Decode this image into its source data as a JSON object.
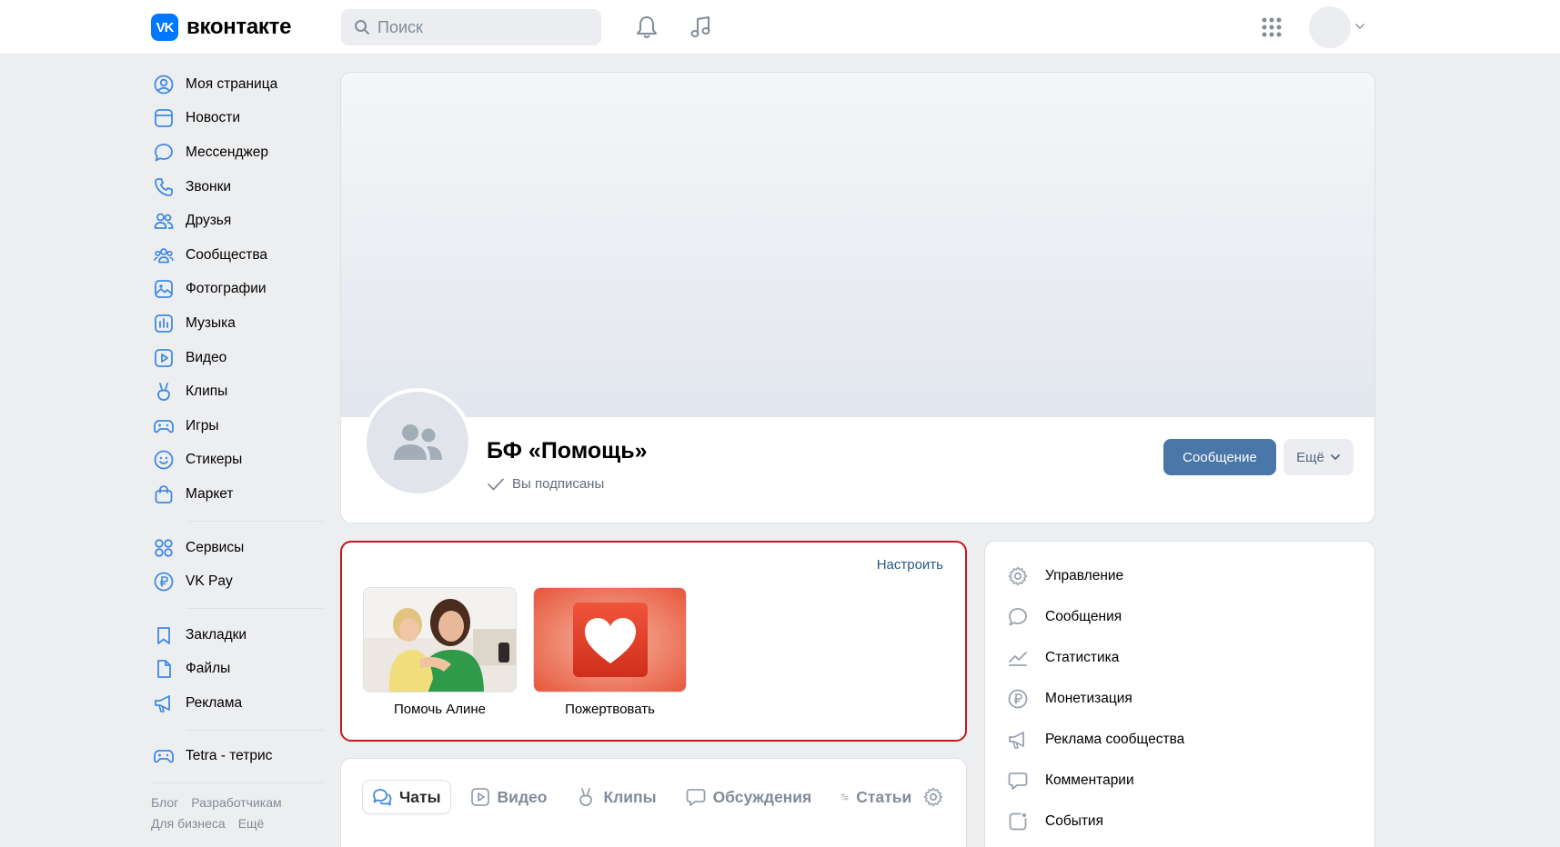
{
  "header": {
    "logo_mark": "VK",
    "logo_text": "вконтакте",
    "search_placeholder": "Поиск",
    "icons": [
      "bell-icon",
      "music-icon",
      "apps-grid-icon",
      "chevron-down-icon"
    ]
  },
  "sidebar": {
    "items": [
      {
        "label": "Моя страница",
        "icon": "user-circle-icon"
      },
      {
        "label": "Новости",
        "icon": "news-icon"
      },
      {
        "label": "Мессенджер",
        "icon": "message-icon"
      },
      {
        "label": "Звонки",
        "icon": "phone-icon"
      },
      {
        "label": "Друзья",
        "icon": "friends-icon"
      },
      {
        "label": "Сообщества",
        "icon": "communities-icon"
      },
      {
        "label": "Фотографии",
        "icon": "photo-icon"
      },
      {
        "label": "Музыка",
        "icon": "music-icon"
      },
      {
        "label": "Видео",
        "icon": "video-icon"
      },
      {
        "label": "Клипы",
        "icon": "clips-icon"
      },
      {
        "label": "Игры",
        "icon": "gamepad-icon"
      },
      {
        "label": "Стикеры",
        "icon": "smile-icon"
      },
      {
        "label": "Маркет",
        "icon": "market-bag-icon"
      }
    ],
    "items2": [
      {
        "label": "Сервисы",
        "icon": "services-grid-icon"
      },
      {
        "label": "VK Pay",
        "icon": "ruble-circle-icon"
      }
    ],
    "items3": [
      {
        "label": "Закладки",
        "icon": "bookmark-icon"
      },
      {
        "label": "Файлы",
        "icon": "file-icon"
      },
      {
        "label": "Реклама",
        "icon": "megaphone-icon"
      }
    ],
    "items4": [
      {
        "label": "Tetra - тетрис",
        "icon": "gamepad-icon"
      }
    ],
    "footer": {
      "blog": "Блог",
      "developers": "Разработчикам",
      "business": "Для бизнеса",
      "more": "Ещё"
    }
  },
  "profile": {
    "name": "БФ «Помощь»",
    "status": "Вы подписаны",
    "message_button": "Сообщение",
    "more_button": "Ещё"
  },
  "widgets": {
    "configure": "Настроить",
    "items": [
      {
        "label": "Помочь Алине"
      },
      {
        "label": "Пожертвовать"
      }
    ]
  },
  "tabs": [
    {
      "label": "Чаты",
      "icon": "chats-icon",
      "active": true
    },
    {
      "label": "Видео",
      "icon": "video-icon",
      "active": false
    },
    {
      "label": "Клипы",
      "icon": "clips-icon",
      "active": false
    },
    {
      "label": "Обсуждения",
      "icon": "discussions-icon",
      "active": false
    },
    {
      "label": "Статьи",
      "icon": "articles-icon",
      "active": false
    }
  ],
  "manage": {
    "items": [
      {
        "label": "Управление",
        "icon": "gear-icon"
      },
      {
        "label": "Сообщения",
        "icon": "message-icon"
      },
      {
        "label": "Статистика",
        "icon": "stats-icon"
      },
      {
        "label": "Монетизация",
        "icon": "ruble-circle-icon"
      },
      {
        "label": "Реклама сообщества",
        "icon": "megaphone-icon"
      },
      {
        "label": "Комментарии",
        "icon": "comment-icon"
      },
      {
        "label": "События",
        "icon": "events-icon"
      }
    ]
  },
  "colors": {
    "brand": "#0077ff",
    "button": "#4a76a8",
    "icon": "#3f8ae0",
    "widget_border": "#c2181e",
    "link": "#2a5885"
  }
}
